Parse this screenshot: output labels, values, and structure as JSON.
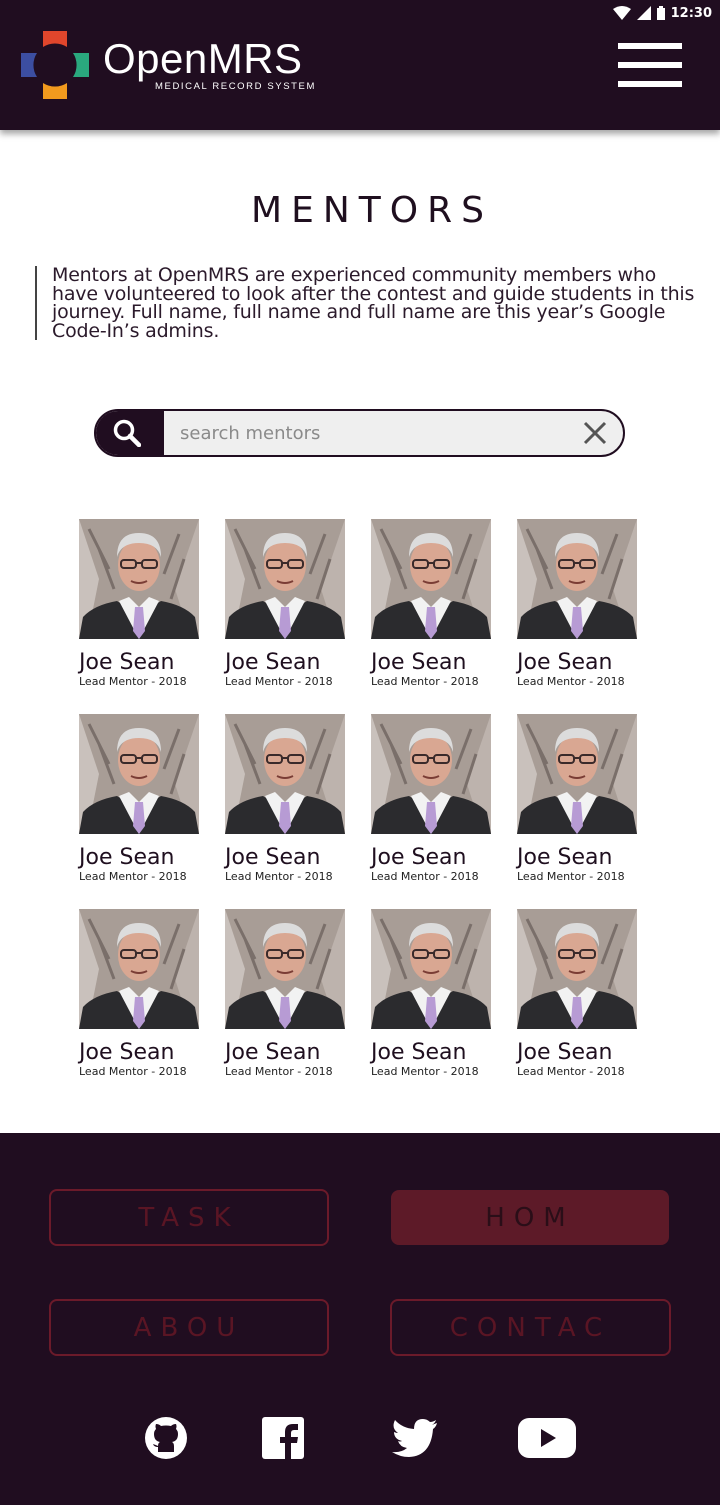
{
  "status_bar": {
    "time": "12:30"
  },
  "header": {
    "app_name": "OpenMRS",
    "app_subtitle": "MEDICAL RECORD SYSTEM",
    "menu_icon": "hamburger-icon",
    "bg_color": "#200d20"
  },
  "main": {
    "title": "MENTORS",
    "intro": "Mentors at OpenMRS are experienced community members who have volunteered to look after the contest and guide students in this journey. Full name, full name and full name are this year’s Google Code-In’s admins.",
    "search": {
      "placeholder": "search mentors",
      "value": "",
      "search_icon": "search-icon",
      "clear_icon": "close-icon"
    }
  },
  "mentors": [
    {
      "name": "Joe Sean",
      "role": "Lead Mentor - 2018"
    },
    {
      "name": "Joe Sean",
      "role": "Lead Mentor - 2018"
    },
    {
      "name": "Joe Sean",
      "role": "Lead Mentor - 2018"
    },
    {
      "name": "Joe Sean",
      "role": "Lead Mentor - 2018"
    },
    {
      "name": "Joe Sean",
      "role": "Lead Mentor - 2018"
    },
    {
      "name": "Joe Sean",
      "role": "Lead Mentor - 2018"
    },
    {
      "name": "Joe Sean",
      "role": "Lead Mentor - 2018"
    },
    {
      "name": "Joe Sean",
      "role": "Lead Mentor - 2018"
    },
    {
      "name": "Joe Sean",
      "role": "Lead Mentor - 2018"
    },
    {
      "name": "Joe Sean",
      "role": "Lead Mentor - 2018"
    },
    {
      "name": "Joe Sean",
      "role": "Lead Mentor - 2018"
    },
    {
      "name": "Joe Sean",
      "role": "Lead Mentor - 2018"
    }
  ],
  "footer": {
    "nav": [
      {
        "label": "TASK",
        "active": false
      },
      {
        "label": "HOM",
        "active": true
      },
      {
        "label": "ABOU",
        "active": false
      },
      {
        "label": "CONTAC",
        "active": false
      }
    ],
    "social": [
      "github-icon",
      "facebook-icon",
      "twitter-icon",
      "youtube-icon"
    ],
    "accent_color": "#6b1a2a"
  }
}
